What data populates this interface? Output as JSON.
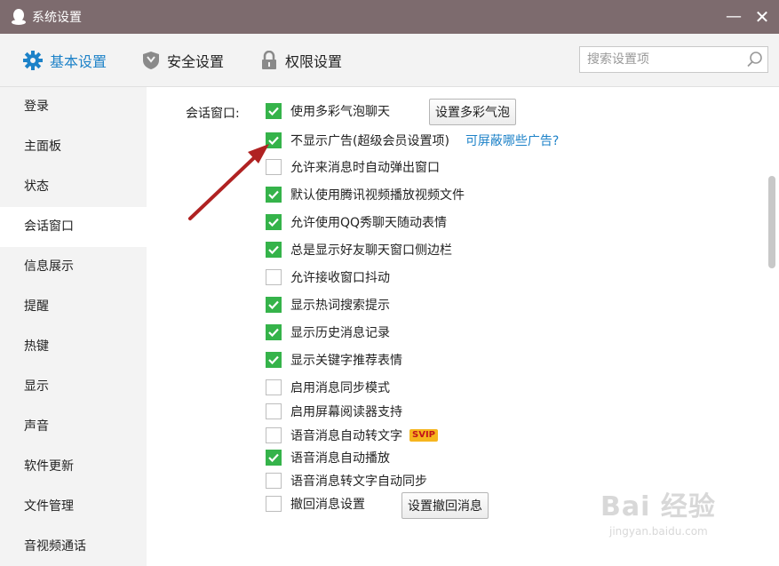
{
  "window": {
    "title": "系统设置",
    "minimize": "—",
    "close": "✕"
  },
  "topnav": {
    "tabs": [
      {
        "label": "基本设置",
        "icon": "gear-icon",
        "active": true
      },
      {
        "label": "安全设置",
        "icon": "shield-icon",
        "active": false
      },
      {
        "label": "权限设置",
        "icon": "lock-icon",
        "active": false
      }
    ],
    "search_placeholder": "搜索设置项"
  },
  "sidebar": {
    "items": [
      {
        "label": "登录"
      },
      {
        "label": "主面板"
      },
      {
        "label": "状态"
      },
      {
        "label": "会话窗口",
        "active": true
      },
      {
        "label": "信息展示"
      },
      {
        "label": "提醒"
      },
      {
        "label": "热键"
      },
      {
        "label": "显示"
      },
      {
        "label": "声音"
      },
      {
        "label": "软件更新"
      },
      {
        "label": "文件管理"
      },
      {
        "label": "音视频通话"
      }
    ]
  },
  "content": {
    "section_label": "会话窗口:",
    "options": [
      {
        "label": "使用多彩气泡聊天",
        "checked": true
      },
      {
        "label": "不显示广告(超级会员设置项)",
        "checked": true
      },
      {
        "label": "允许来消息时自动弹出窗口",
        "checked": false
      },
      {
        "label": "默认使用腾讯视频播放视频文件",
        "checked": true
      },
      {
        "label": "允许使用QQ秀聊天随动表情",
        "checked": true
      },
      {
        "label": "总是显示好友聊天窗口侧边栏",
        "checked": true
      },
      {
        "label": "允许接收窗口抖动",
        "checked": false
      },
      {
        "label": "显示热词搜索提示",
        "checked": true
      },
      {
        "label": "显示历史消息记录",
        "checked": true
      },
      {
        "label": "显示关键字推荐表情",
        "checked": true
      },
      {
        "label": "启用消息同步模式",
        "checked": false
      },
      {
        "label": "启用屏幕阅读器支持",
        "checked": false
      },
      {
        "label": "语音消息自动转文字",
        "checked": false
      },
      {
        "label": "语音消息自动播放",
        "checked": true
      },
      {
        "label": "语音消息转文字自动同步",
        "checked": false
      },
      {
        "label": "撤回消息设置",
        "checked": false
      }
    ],
    "bubble_button": "设置多彩气泡",
    "ad_link": "可屏蔽哪些广告?",
    "svip_badge": "SVIP",
    "recall_button": "设置撤回消息"
  },
  "watermark": {
    "main": "Bai 经验",
    "sub": "jingyan.baidu.com"
  },
  "colors": {
    "titlebar": "#7d6b6e",
    "accent": "#1d82c8",
    "check": "#35b34a",
    "arrow": "#b02222"
  }
}
